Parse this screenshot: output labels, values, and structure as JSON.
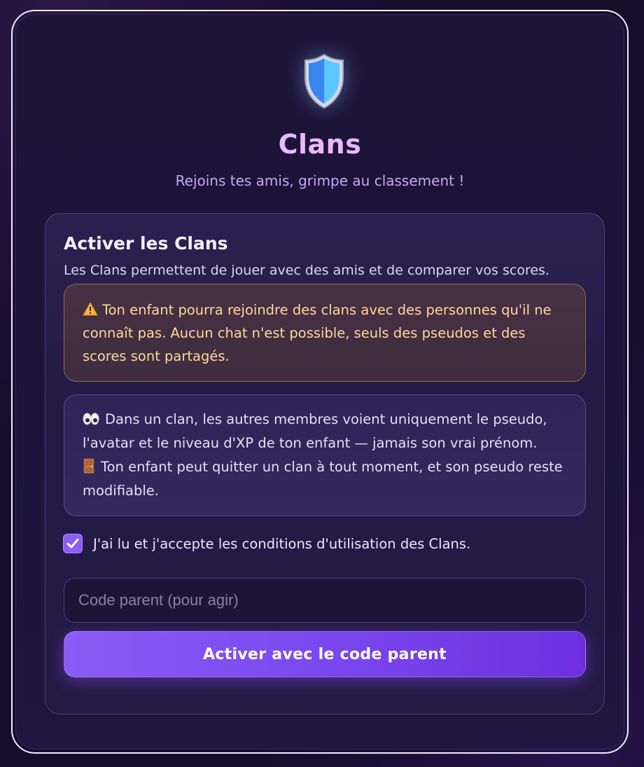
{
  "header": {
    "icon": "shield-icon",
    "title": "Clans",
    "subtitle": "Rejoins tes amis, grimpe au classement !"
  },
  "card": {
    "title": "Activer les Clans",
    "description": "Les Clans permettent de jouer avec des amis et de comparer vos scores.",
    "warning": {
      "icon": "warning-icon",
      "text": "Ton enfant pourra rejoindre des clans avec des personnes qu'il ne connaît pas. Aucun chat n'est possible, seuls des pseudos et des scores sont partagés."
    },
    "info": {
      "line1_icon": "eyes-icon",
      "line1": "Dans un clan, les autres membres voient uniquement le pseudo, l'avatar et le niveau d'XP de ton enfant — jamais son vrai prénom.",
      "line2_icon": "door-icon",
      "line2": "Ton enfant peut quitter un clan à tout moment, et son pseudo reste modifiable."
    },
    "consent": {
      "checked": true,
      "label": "J'ai lu et j'accepte les conditions d'utilisation des Clans."
    },
    "parent_code": {
      "value": "",
      "placeholder": "Code parent (pour agir)"
    },
    "activate_label": "Activer avec le code parent"
  },
  "colors": {
    "background": "#140d2b",
    "title": "#eab8ff",
    "subtitle": "#c4a8f4",
    "warning_text": "#ffd89a",
    "accent": "#8b5cf6"
  }
}
